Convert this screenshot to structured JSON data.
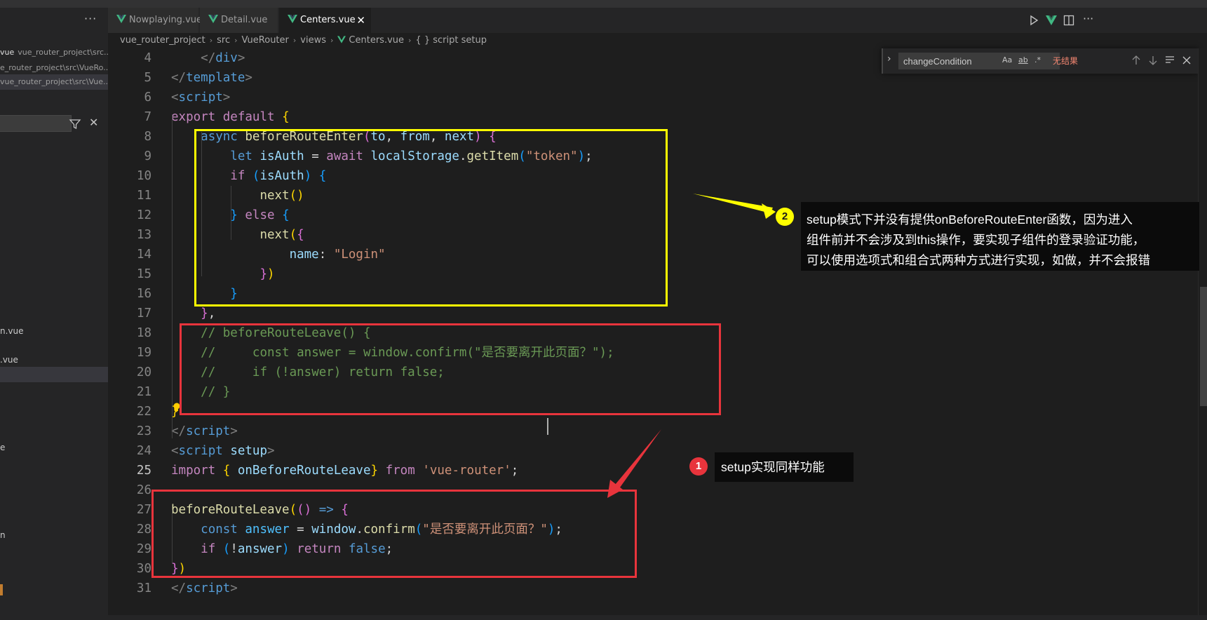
{
  "sidebar": {
    "more_label": "···",
    "open_editors": [
      {
        "name": "vue",
        "path": "vue_router_project\\src..."
      },
      {
        "name": "",
        "path": "e_router_project\\src\\VueRo..."
      },
      {
        "name": "",
        "path": "vue_router_project\\src\\Vue..."
      }
    ],
    "tree_items": [
      "n.vue",
      ".vue",
      "e",
      "n"
    ]
  },
  "tabs": [
    {
      "label": "Nowplaying.vue",
      "close": ""
    },
    {
      "label": "Detail.vue",
      "close": ""
    },
    {
      "label": "Centers.vue",
      "close": "✕"
    }
  ],
  "breadcrumb": [
    "vue_router_project",
    "src",
    "VueRouter",
    "views",
    "Centers.vue",
    "{ } script setup"
  ],
  "find_widget": {
    "value": "changeCondition",
    "result": "无结果",
    "options": [
      "Aa",
      "ab",
      ".*"
    ]
  },
  "code_lines": [
    {
      "n": "4",
      "t": [
        [
          "    ",
          "#d4d4d4"
        ],
        [
          "</",
          "#808080"
        ],
        [
          "div",
          "#569cd6"
        ],
        [
          ">",
          "#808080"
        ]
      ]
    },
    {
      "n": "5",
      "t": [
        [
          "</",
          "#808080"
        ],
        [
          "template",
          "#569cd6"
        ],
        [
          ">",
          "#808080"
        ]
      ]
    },
    {
      "n": "6",
      "t": [
        [
          "<",
          "#808080"
        ],
        [
          "script",
          "#569cd6"
        ],
        [
          ">",
          "#808080"
        ]
      ]
    },
    {
      "n": "7",
      "t": [
        [
          "export",
          "#c586c0"
        ],
        [
          " ",
          "#d4d4d4"
        ],
        [
          "default",
          "#c586c0"
        ],
        [
          " ",
          "#d4d4d4"
        ],
        [
          "{",
          "#ffd700"
        ]
      ]
    },
    {
      "n": "8",
      "t": [
        [
          "    ",
          "#d4d4d4"
        ],
        [
          "async",
          "#569cd6"
        ],
        [
          " ",
          "#d4d4d4"
        ],
        [
          "beforeRouteEnter",
          "#dcdcaa"
        ],
        [
          "(",
          "#da70d6"
        ],
        [
          "to",
          "#9cdcfe"
        ],
        [
          ", ",
          "#d4d4d4"
        ],
        [
          "from",
          "#9cdcfe"
        ],
        [
          ", ",
          "#d4d4d4"
        ],
        [
          "next",
          "#9cdcfe"
        ],
        [
          ") ",
          "#da70d6"
        ],
        [
          "{",
          "#da70d6"
        ]
      ]
    },
    {
      "n": "9",
      "t": [
        [
          "        ",
          "#d4d4d4"
        ],
        [
          "let",
          "#569cd6"
        ],
        [
          " ",
          "#d4d4d4"
        ],
        [
          "isAuth",
          "#9cdcfe"
        ],
        [
          " = ",
          "#d4d4d4"
        ],
        [
          "await",
          "#c586c0"
        ],
        [
          " ",
          "#d4d4d4"
        ],
        [
          "localStorage",
          "#9cdcfe"
        ],
        [
          ".",
          "#d4d4d4"
        ],
        [
          "getItem",
          "#dcdcaa"
        ],
        [
          "(",
          "#179fff"
        ],
        [
          "\"token\"",
          "#ce9178"
        ],
        [
          ")",
          "#179fff"
        ],
        [
          ";",
          "#d4d4d4"
        ]
      ]
    },
    {
      "n": "10",
      "t": [
        [
          "        ",
          "#d4d4d4"
        ],
        [
          "if",
          "#c586c0"
        ],
        [
          " ",
          "#d4d4d4"
        ],
        [
          "(",
          "#179fff"
        ],
        [
          "isAuth",
          "#9cdcfe"
        ],
        [
          ")",
          "#179fff"
        ],
        [
          " ",
          "#d4d4d4"
        ],
        [
          "{",
          "#179fff"
        ]
      ]
    },
    {
      "n": "11",
      "t": [
        [
          "            ",
          "#d4d4d4"
        ],
        [
          "next",
          "#dcdcaa"
        ],
        [
          "()",
          "#ffd700"
        ]
      ]
    },
    {
      "n": "12",
      "t": [
        [
          "        ",
          "#d4d4d4"
        ],
        [
          "}",
          "#179fff"
        ],
        [
          " ",
          "#d4d4d4"
        ],
        [
          "else",
          "#c586c0"
        ],
        [
          " ",
          "#d4d4d4"
        ],
        [
          "{",
          "#179fff"
        ]
      ]
    },
    {
      "n": "13",
      "t": [
        [
          "            ",
          "#d4d4d4"
        ],
        [
          "next",
          "#dcdcaa"
        ],
        [
          "(",
          "#ffd700"
        ],
        [
          "{",
          "#da70d6"
        ]
      ]
    },
    {
      "n": "14",
      "t": [
        [
          "                ",
          "#d4d4d4"
        ],
        [
          "name",
          "#9cdcfe"
        ],
        [
          ": ",
          "#d4d4d4"
        ],
        [
          "\"Login\"",
          "#ce9178"
        ]
      ]
    },
    {
      "n": "15",
      "t": [
        [
          "            ",
          "#d4d4d4"
        ],
        [
          "}",
          "#da70d6"
        ],
        [
          ")",
          "#ffd700"
        ]
      ]
    },
    {
      "n": "16",
      "t": [
        [
          "        ",
          "#d4d4d4"
        ],
        [
          "}",
          "#179fff"
        ]
      ]
    },
    {
      "n": "17",
      "t": [
        [
          "    ",
          "#d4d4d4"
        ],
        [
          "}",
          "#da70d6"
        ],
        [
          ",",
          "#d4d4d4"
        ]
      ]
    },
    {
      "n": "18",
      "t": [
        [
          "    ",
          "#d4d4d4"
        ],
        [
          "// beforeRouteLeave() {",
          "#6a9955"
        ]
      ]
    },
    {
      "n": "19",
      "t": [
        [
          "    ",
          "#d4d4d4"
        ],
        [
          "//     const answer = window.confirm(\"是否要离开此页面？\");",
          "#6a9955"
        ]
      ]
    },
    {
      "n": "20",
      "t": [
        [
          "    ",
          "#d4d4d4"
        ],
        [
          "//     if (!answer) return false;",
          "#6a9955"
        ]
      ]
    },
    {
      "n": "21",
      "t": [
        [
          "    ",
          "#d4d4d4"
        ],
        [
          "// }",
          "#6a9955"
        ]
      ]
    },
    {
      "n": "22",
      "t": [
        [
          "}",
          "#ffd700"
        ]
      ]
    },
    {
      "n": "23",
      "t": [
        [
          "</",
          "#808080"
        ],
        [
          "script",
          "#569cd6"
        ],
        [
          ">",
          "#808080"
        ]
      ]
    },
    {
      "n": "24",
      "t": [
        [
          "<",
          "#808080"
        ],
        [
          "script",
          "#569cd6"
        ],
        [
          " ",
          "#d4d4d4"
        ],
        [
          "setup",
          "#9cdcfe"
        ],
        [
          ">",
          "#808080"
        ]
      ]
    },
    {
      "n": "25",
      "t": [
        [
          "import",
          "#c586c0"
        ],
        [
          " ",
          "#d4d4d4"
        ],
        [
          "{",
          "#ffd700"
        ],
        [
          " ",
          "#d4d4d4"
        ],
        [
          "onBeforeRouteLeave",
          "#9cdcfe"
        ],
        [
          "}",
          "#ffd700"
        ],
        [
          " ",
          "#d4d4d4"
        ],
        [
          "from",
          "#c586c0"
        ],
        [
          " ",
          "#d4d4d4"
        ],
        [
          "'vue-router'",
          "#ce9178"
        ],
        [
          ";",
          "#d4d4d4"
        ]
      ]
    },
    {
      "n": "26",
      "t": []
    },
    {
      "n": "27",
      "t": [
        [
          "beforeRouteLeave",
          "#dcdcaa"
        ],
        [
          "(",
          "#ffd700"
        ],
        [
          "()",
          "#da70d6"
        ],
        [
          " ",
          "#d4d4d4"
        ],
        [
          "=>",
          "#569cd6"
        ],
        [
          " ",
          "#d4d4d4"
        ],
        [
          "{",
          "#da70d6"
        ]
      ]
    },
    {
      "n": "28",
      "t": [
        [
          "    ",
          "#d4d4d4"
        ],
        [
          "const",
          "#569cd6"
        ],
        [
          " ",
          "#d4d4d4"
        ],
        [
          "answer",
          "#4fc1ff"
        ],
        [
          " = ",
          "#d4d4d4"
        ],
        [
          "window",
          "#9cdcfe"
        ],
        [
          ".",
          "#d4d4d4"
        ],
        [
          "confirm",
          "#dcdcaa"
        ],
        [
          "(",
          "#179fff"
        ],
        [
          "\"是否要离开此页面？\"",
          "#ce9178"
        ],
        [
          ")",
          "#179fff"
        ],
        [
          ";",
          "#d4d4d4"
        ]
      ]
    },
    {
      "n": "29",
      "t": [
        [
          "    ",
          "#d4d4d4"
        ],
        [
          "if",
          "#c586c0"
        ],
        [
          " ",
          "#d4d4d4"
        ],
        [
          "(",
          "#179fff"
        ],
        [
          "!",
          "#d4d4d4"
        ],
        [
          "answer",
          "#9cdcfe"
        ],
        [
          ")",
          "#179fff"
        ],
        [
          " ",
          "#d4d4d4"
        ],
        [
          "return",
          "#c586c0"
        ],
        [
          " ",
          "#d4d4d4"
        ],
        [
          "false",
          "#569cd6"
        ],
        [
          ";",
          "#d4d4d4"
        ]
      ]
    },
    {
      "n": "30",
      "t": [
        [
          "}",
          "#da70d6"
        ],
        [
          ")",
          "#ffd700"
        ]
      ]
    },
    {
      "n": "31",
      "t": [
        [
          "</",
          "#808080"
        ],
        [
          "script",
          "#569cd6"
        ],
        [
          ">",
          "#808080"
        ]
      ]
    }
  ],
  "annotations": {
    "callout_2": {
      "marker": "2",
      "lines": [
        "setup模式下并没有提供onBeforeRouteEnter函数，因为进入",
        "组件前并不会涉及到this操作，要实现子组件的登录验证功能，",
        "可以使用选项式和组合式两种方式进行实现，如做，并不会报错"
      ]
    },
    "callout_1": {
      "marker": "1",
      "text": "setup实现同样功能"
    }
  },
  "colors": {
    "accent_yellow": "#ffff00",
    "accent_red": "#e8343c",
    "vue_green": "#41b883"
  }
}
